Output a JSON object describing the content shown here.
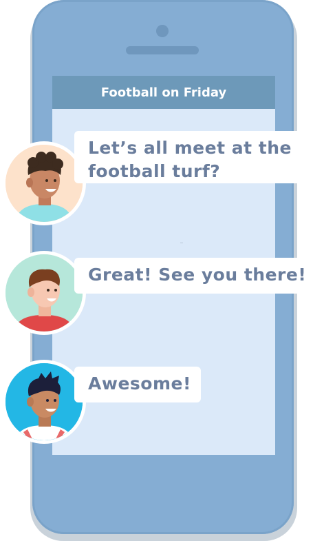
{
  "chat": {
    "title": "Football on Friday",
    "messages": [
      {
        "line1": "Let’s all meet at the",
        "line2": "football turf?",
        "avatar_bg": "#fde2cb"
      },
      {
        "line1": "Great! See you there!",
        "avatar_bg": "#b6e7da"
      },
      {
        "line1": "Awesome!",
        "avatar_bg": "#23b7e5"
      }
    ]
  },
  "colors": {
    "phone_body": "#85add3",
    "screen": "#dbe9f9",
    "header": "#6d99b9",
    "bubble_text": "#6a7d9c"
  },
  "icons": [
    "camera-icon",
    "speaker-grille-icon"
  ]
}
